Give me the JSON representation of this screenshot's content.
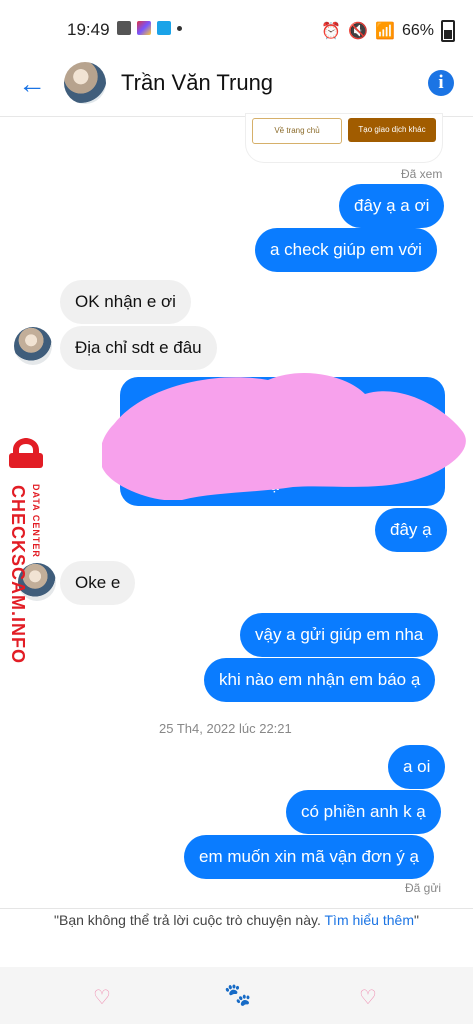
{
  "status": {
    "time": "19:49",
    "battery": "66%"
  },
  "header": {
    "back_icon": "back-arrow-icon",
    "contact_name": "Trần Văn Trung",
    "info_icon": "info-icon"
  },
  "embedded_screenshot": {
    "button_left": "Về trang chủ",
    "button_right": "Tạo giao dịch khác"
  },
  "read_status_top": "Đã xem",
  "messages": [
    {
      "side": "out",
      "text": "đây ạ a ơi"
    },
    {
      "side": "out",
      "text": "a check giúp em với"
    },
    {
      "side": "in",
      "text": "OK nhận e ơi"
    },
    {
      "side": "in",
      "text": "Địa chỉ sdt e đâu"
    },
    {
      "side": "out",
      "text": "đây ạ"
    },
    {
      "side": "in",
      "text": "Oke e"
    },
    {
      "side": "out",
      "text": "vậy a gửi giúp em nha"
    },
    {
      "side": "out",
      "text": "khi nào em nhận em báo ạ"
    },
    {
      "side": "out",
      "text": "a oi"
    },
    {
      "side": "out",
      "text": "có phiền anh k ạ"
    },
    {
      "side": "out",
      "text": "em muốn xin mã vận đơn ý ạ"
    }
  ],
  "image_fragment": "ạ",
  "timestamp": "25 Th4, 2022 lúc 22:21",
  "sent_status": "Đã gửi",
  "watermark": {
    "main": "CHECKSCAM.INFO",
    "sub": "DATA CENTER"
  },
  "notice": {
    "text": "\"Bạn không thể trả lời cuộc trò chuyện này. ",
    "link": "Tìm hiểu thêm",
    "end": "\""
  },
  "colors": {
    "accent": "#1b74e4",
    "outgoing_bubble": "#0a7cff",
    "incoming_bubble": "#f0f0f0",
    "watermark": "#e21d25"
  }
}
